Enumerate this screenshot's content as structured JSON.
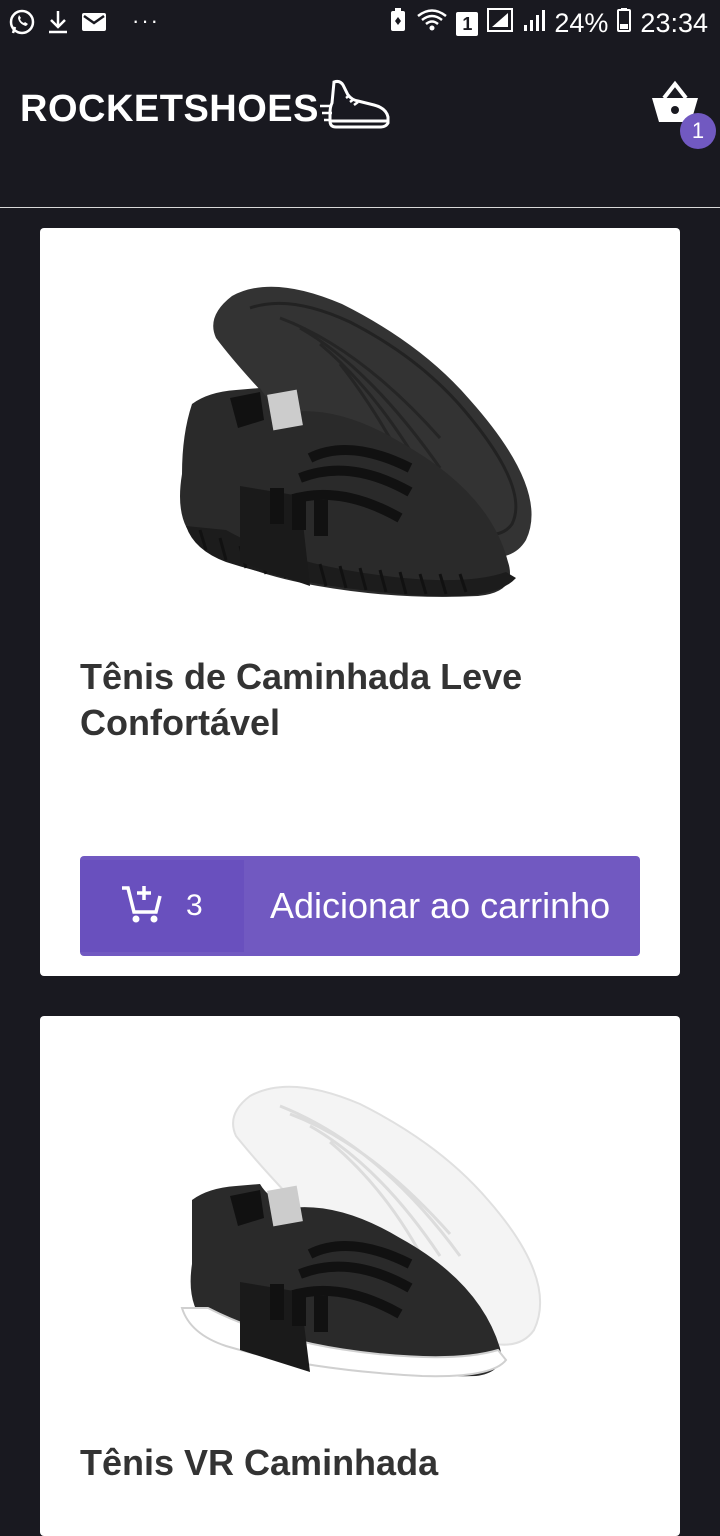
{
  "status_bar": {
    "sim_slot": "1",
    "battery": "24%",
    "time": "23:34",
    "more_indicator": "···"
  },
  "header": {
    "brand": "ROCKETSHOES",
    "cart_count": "1"
  },
  "products": [
    {
      "title": " Tênis de Caminhada Leve Confortável",
      "amount_in_cart": "3",
      "button_label": "Adicionar ao carrinho",
      "image_icon": "black-sneaker-image"
    },
    {
      "title": " Tênis VR Caminhada",
      "image_icon": "black-white-sneaker-image"
    }
  ],
  "colors": {
    "background": "#191920",
    "accent": "#7159c1",
    "accent_dark": "#6950be",
    "card": "#ffffff",
    "title_text": "#333333"
  }
}
